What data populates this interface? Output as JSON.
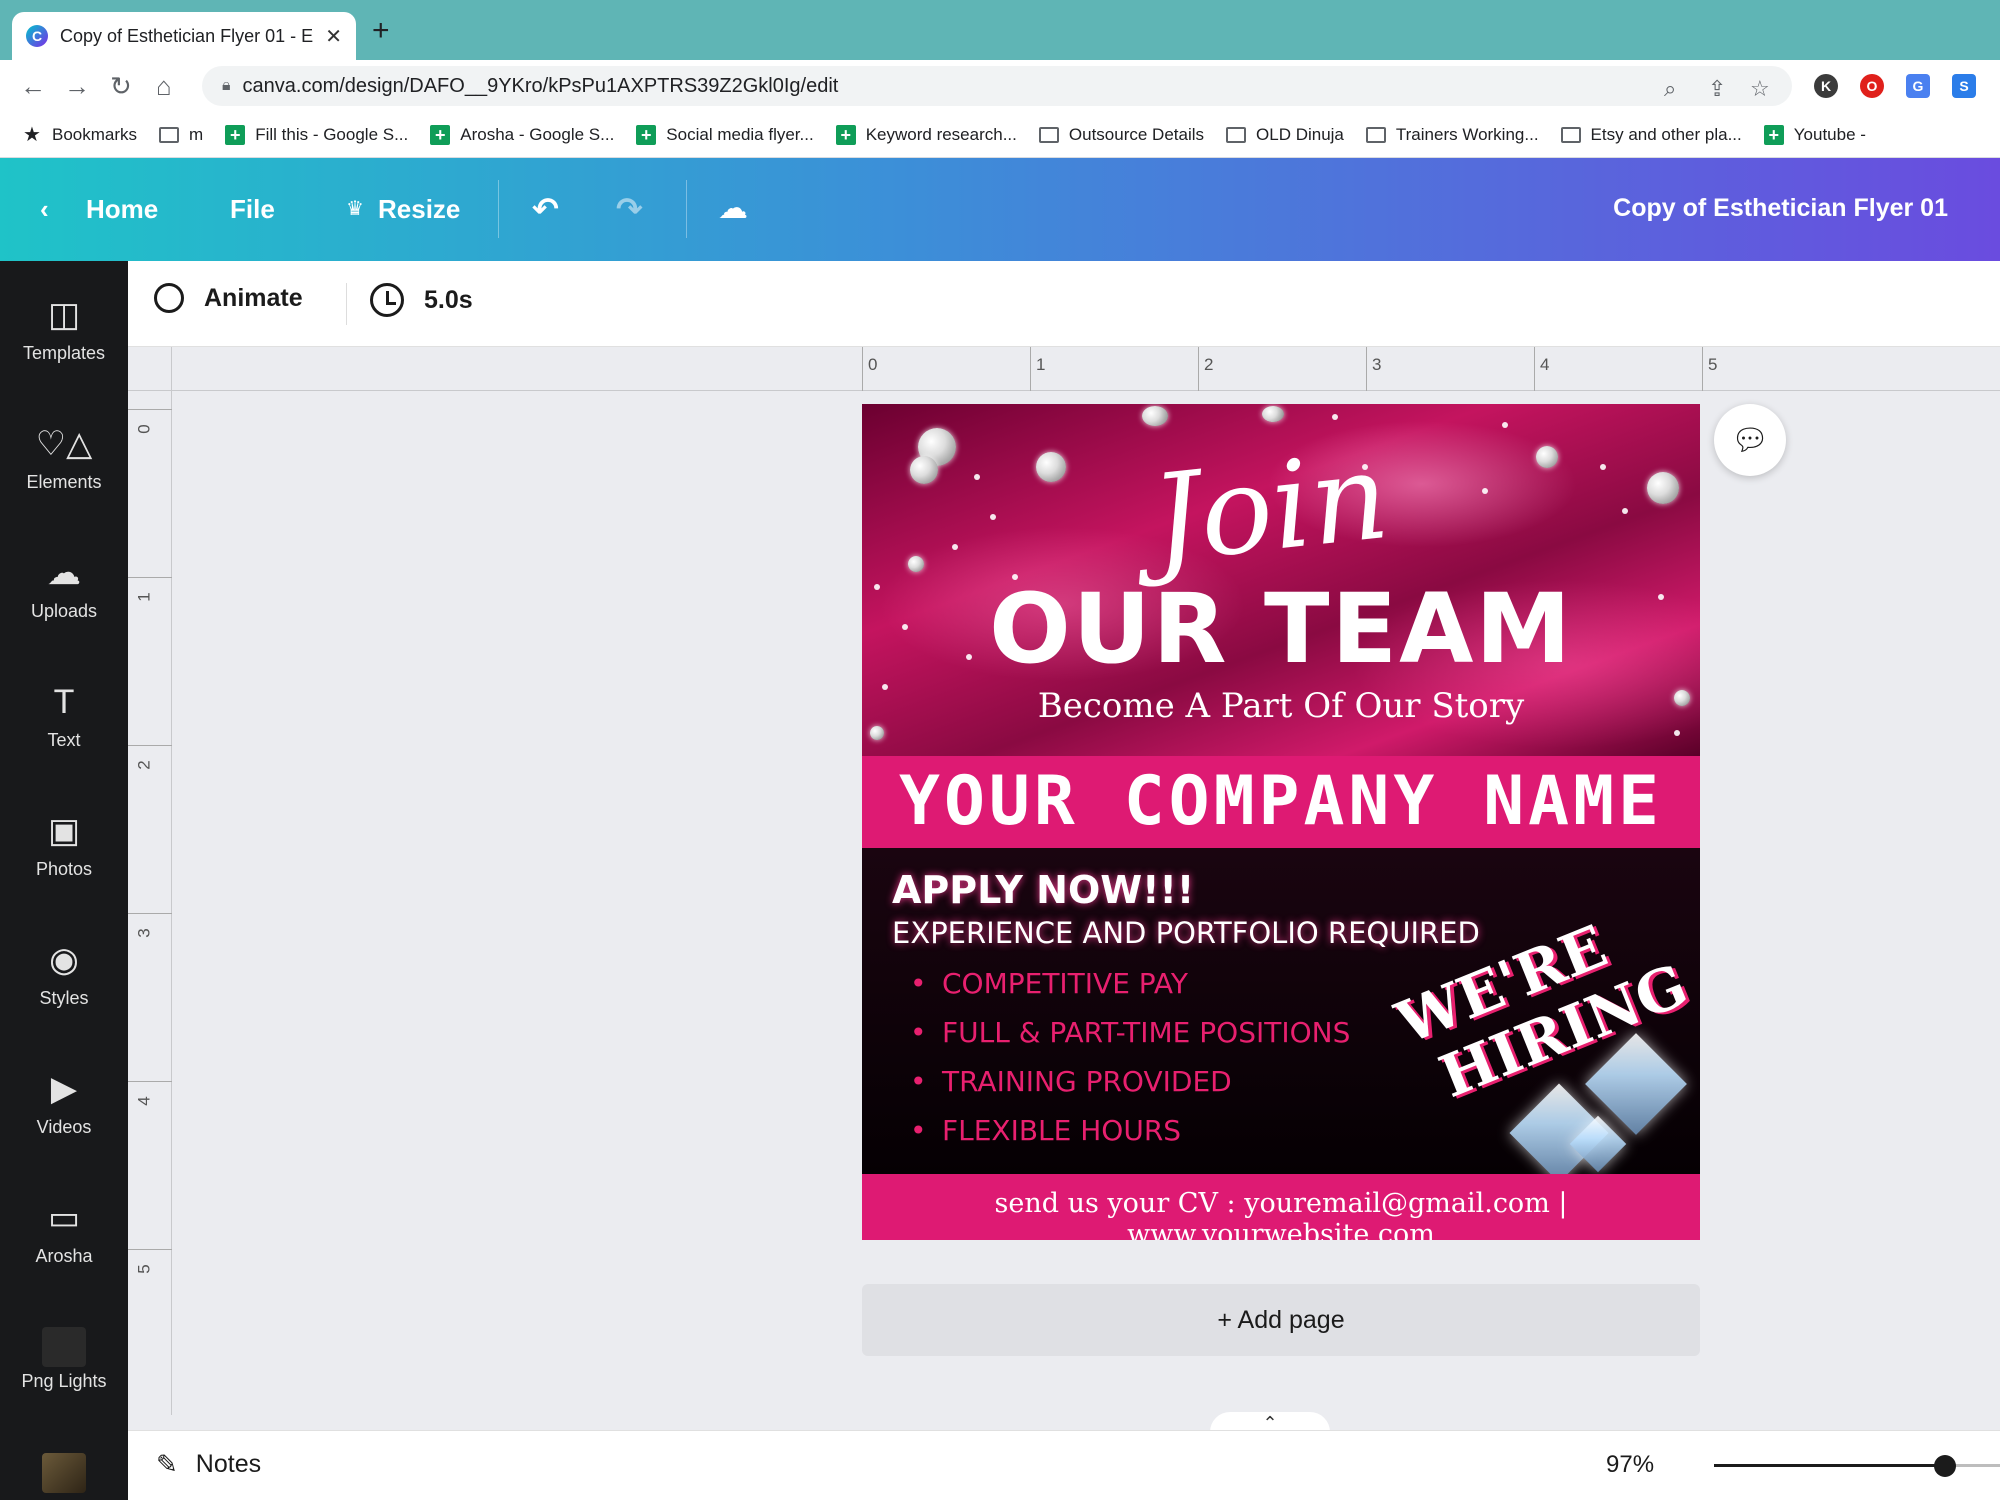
{
  "browser": {
    "tab_title": "Copy of Esthetician Flyer 01 - E",
    "new_tab": "+",
    "url": "canva.com/design/DAFO__9YKro/kPsPu1AXPTRS39Z2Gkl0Ig/edit",
    "bookmarks": [
      {
        "label": "Bookmarks",
        "icon": "star-icon"
      },
      {
        "label": "m",
        "icon": "folder-icon"
      },
      {
        "label": "Fill this - Google S...",
        "icon": "sheets-icon"
      },
      {
        "label": "Arosha - Google S...",
        "icon": "sheets-icon"
      },
      {
        "label": "Social media flyer...",
        "icon": "sheets-icon"
      },
      {
        "label": "Keyword research...",
        "icon": "sheets-icon"
      },
      {
        "label": "Outsource Details",
        "icon": "folder-icon"
      },
      {
        "label": "OLD Dinuja",
        "icon": "folder-icon"
      },
      {
        "label": "Trainers Working...",
        "icon": "folder-icon"
      },
      {
        "label": "Etsy and other pla...",
        "icon": "folder-icon"
      },
      {
        "label": "Youtube -",
        "icon": "sheets-icon"
      }
    ]
  },
  "header": {
    "home": "Home",
    "file": "File",
    "resize": "Resize",
    "doc_title": "Copy of Esthetician Flyer 01"
  },
  "sidebar": {
    "items": [
      {
        "label": "Templates"
      },
      {
        "label": "Elements"
      },
      {
        "label": "Uploads"
      },
      {
        "label": "Text"
      },
      {
        "label": "Photos"
      },
      {
        "label": "Styles"
      },
      {
        "label": "Videos"
      },
      {
        "label": "Arosha"
      },
      {
        "label": "Png Lights"
      }
    ]
  },
  "context_bar": {
    "animate": "Animate",
    "duration": "5.0s"
  },
  "ruler": {
    "top": [
      "0",
      "1",
      "2",
      "3",
      "4",
      "5"
    ],
    "left": [
      "0",
      "1",
      "2",
      "3",
      "4",
      "5"
    ]
  },
  "design": {
    "script_word": "Join",
    "headline": "OUR TEAM",
    "tagline": "Become A Part Of Our Story",
    "company": "YOUR COMPANY NAME",
    "apply": "APPLY NOW!!!",
    "requirement": "EXPERIENCE AND PORTFOLIO REQUIRED",
    "bullets": [
      "COMPETITIVE PAY",
      "FULL & PART-TIME POSITIONS",
      "TRAINING PROVIDED",
      "FLEXIBLE HOURS"
    ],
    "hiring_line1": "WE'RE",
    "hiring_line2": "HIRING",
    "contact": "send us your CV : youremail@gmail.com | www.yourwebsite.com"
  },
  "add_page": "+ Add page",
  "bottom": {
    "notes": "Notes",
    "zoom": "97%",
    "zoom_level": 0.97
  },
  "colors": {
    "brand_pink": "#de1a73",
    "bullet_pink": "#e8206f",
    "header_gradient_start": "#1fc3c8",
    "header_gradient_end": "#6a4cdf"
  }
}
